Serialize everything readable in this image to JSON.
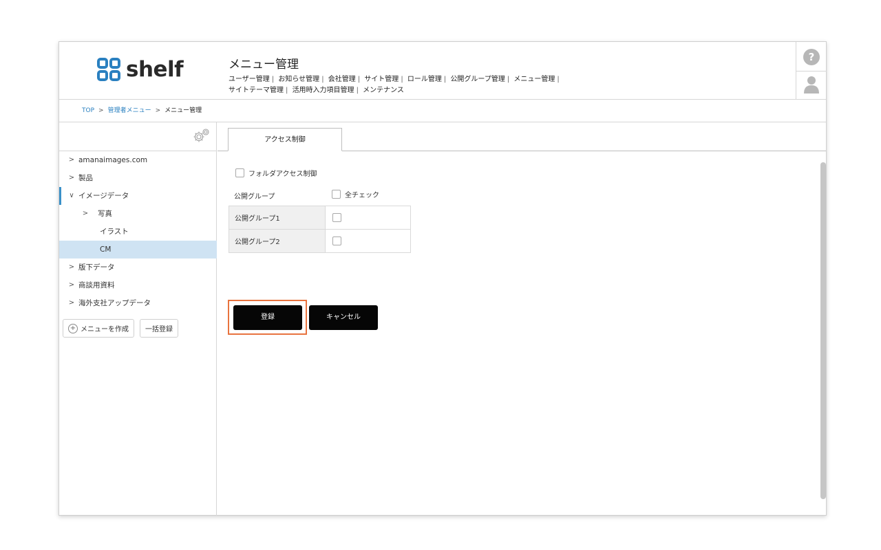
{
  "header": {
    "logo_text": "shelf",
    "title": "メニュー管理",
    "nav_line1": [
      "ユーザー管理",
      "お知らせ管理",
      "会社管理",
      "サイト管理",
      "ロール管理",
      "公開グループ管理",
      "メニュー管理"
    ],
    "nav_line2": [
      "サイトテーマ管理",
      "活用時入力項目管理",
      "メンテナンス"
    ],
    "help_label": "?"
  },
  "breadcrumb": {
    "items": [
      "TOP",
      "管理者メニュー",
      "メニュー管理"
    ],
    "separator": ">"
  },
  "sidebar": {
    "tree": [
      {
        "label": "amanaimages.com",
        "chevron": ">"
      },
      {
        "label": "製品",
        "chevron": ">"
      },
      {
        "label": "イメージデータ",
        "chevron": "∨"
      },
      {
        "label": "写真",
        "chevron": ">"
      },
      {
        "label": "イラスト",
        "chevron": ""
      },
      {
        "label": "CM",
        "chevron": ""
      },
      {
        "label": "版下データ",
        "chevron": ">"
      },
      {
        "label": "商談用資料",
        "chevron": ">"
      },
      {
        "label": "海外支社アップデータ",
        "chevron": ">"
      }
    ],
    "create_menu_label": "メニューを作成",
    "bulk_register_label": "一括登録"
  },
  "main": {
    "tab_label": "アクセス制御",
    "folder_access_label": "フォルダアクセス制御",
    "public_group_label": "公開グループ",
    "check_all_label": "全チェック",
    "groups": [
      "公開グループ1",
      "公開グループ2"
    ],
    "submit_label": "登録",
    "cancel_label": "キャンセル"
  },
  "colors": {
    "logo_accent": "#2a80c0",
    "selected_row": "#cfe3f3",
    "highlight_border": "#e8733e",
    "button_bg": "#060606"
  }
}
